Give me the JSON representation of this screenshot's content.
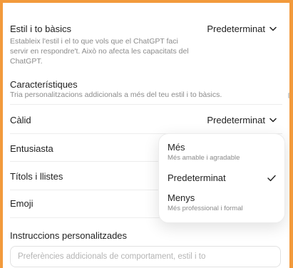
{
  "base_style": {
    "title": "Estil i to bàsics",
    "description_lines": [
      "Estableix l'estil i el to que vols que el ChatGPT faci",
      "servir en respondre't. Això no afecta les capacitats del",
      "ChatGPT."
    ],
    "value": "Predeterminat"
  },
  "characteristics": {
    "title": "Característiques",
    "description": "Tria personalitzacions addicionals a més del teu estil i to bàsics."
  },
  "items": [
    {
      "label": "Càlid",
      "value": "Predeterminat"
    },
    {
      "label": "Entusiasta"
    },
    {
      "label": "Títols i llistes"
    },
    {
      "label": "Emoji"
    }
  ],
  "menu": {
    "options": [
      {
        "label": "Més",
        "sub": "Més amable i agradable"
      },
      {
        "label": "Predeterminat",
        "selected": true
      },
      {
        "label": "Menys",
        "sub": "Més professional i formal"
      }
    ]
  },
  "custom_instructions": {
    "title": "Instruccions personalitzades",
    "placeholder": "Preferències addicionals de comportament, estil i to"
  },
  "icons": {
    "chevron": "chevron-down-icon",
    "check": "check-icon"
  },
  "colors": {
    "frame": "#f29a3c",
    "muted_text": "#8b8b8b"
  }
}
